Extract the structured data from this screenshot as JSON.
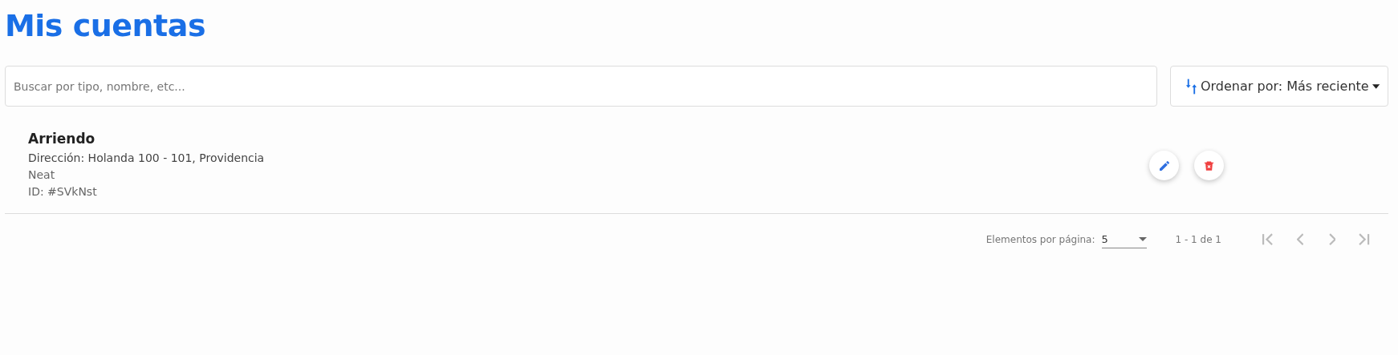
{
  "title": "Mis cuentas",
  "search": {
    "placeholder": "Buscar por tipo, nombre, etc..."
  },
  "sort_button": {
    "label": "Ordenar por: Más reciente"
  },
  "accounts": [
    {
      "name": "Arriendo",
      "address": "Dirección: Holanda 100 - 101, Providencia",
      "provider": "Neat",
      "id": "ID: #SVkNst"
    }
  ],
  "paginator": {
    "page_size_label": "Elementos por página:",
    "page_size": "5",
    "range": "1 - 1 de 1",
    "nav": [
      {
        "kind": "first",
        "disabled": true
      },
      {
        "kind": "previous",
        "disabled": true
      },
      {
        "kind": "next",
        "disabled": true
      },
      {
        "kind": "last",
        "disabled": true
      }
    ]
  }
}
